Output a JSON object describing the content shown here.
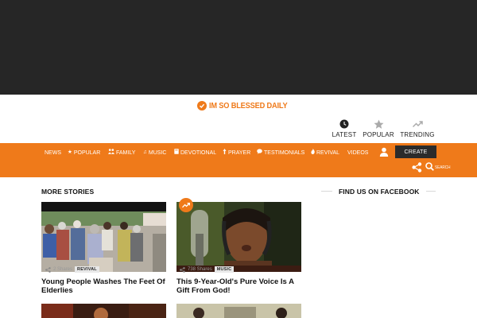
{
  "site": {
    "logo_text": "IM SO BLESSED DAILY",
    "brand_color": "#ef7a1a",
    "dark_color": "#262626"
  },
  "quick_nav": [
    {
      "label": "LATEST",
      "icon": "clock-icon"
    },
    {
      "label": "POPULAR",
      "icon": "star-icon"
    },
    {
      "label": "TRENDING",
      "icon": "trending-icon"
    }
  ],
  "nav": {
    "items": [
      {
        "label": "NEWS",
        "icon": ""
      },
      {
        "label": "POPULAR",
        "icon": "star-icon"
      },
      {
        "label": "FAMILY",
        "icon": "family-icon"
      },
      {
        "label": "MUSIC",
        "icon": "music-icon"
      },
      {
        "label": "DEVOTIONAL",
        "icon": "book-icon"
      },
      {
        "label": "PRAYER",
        "icon": "prayer-icon"
      },
      {
        "label": "TESTIMONIALS",
        "icon": "comment-icon"
      },
      {
        "label": "REVIVAL",
        "icon": "flame-icon"
      },
      {
        "label": "VIDEOS",
        "icon": ""
      }
    ],
    "create_label": "CREATE",
    "search_label": "SEARCH"
  },
  "sections": {
    "more_stories": "MORE STORIES",
    "facebook": "FIND US ON FACEBOOK"
  },
  "cards": [
    {
      "shares": "2 Shares",
      "tag": "REVIVAL",
      "title": "Young People Washes The Feet Of Elderlies",
      "trending": false
    },
    {
      "shares": "738 Shares",
      "tag": "MUSIC",
      "title": "This 9-Year-Old's Pure Voice Is A Gift From God!",
      "trending": true
    }
  ]
}
